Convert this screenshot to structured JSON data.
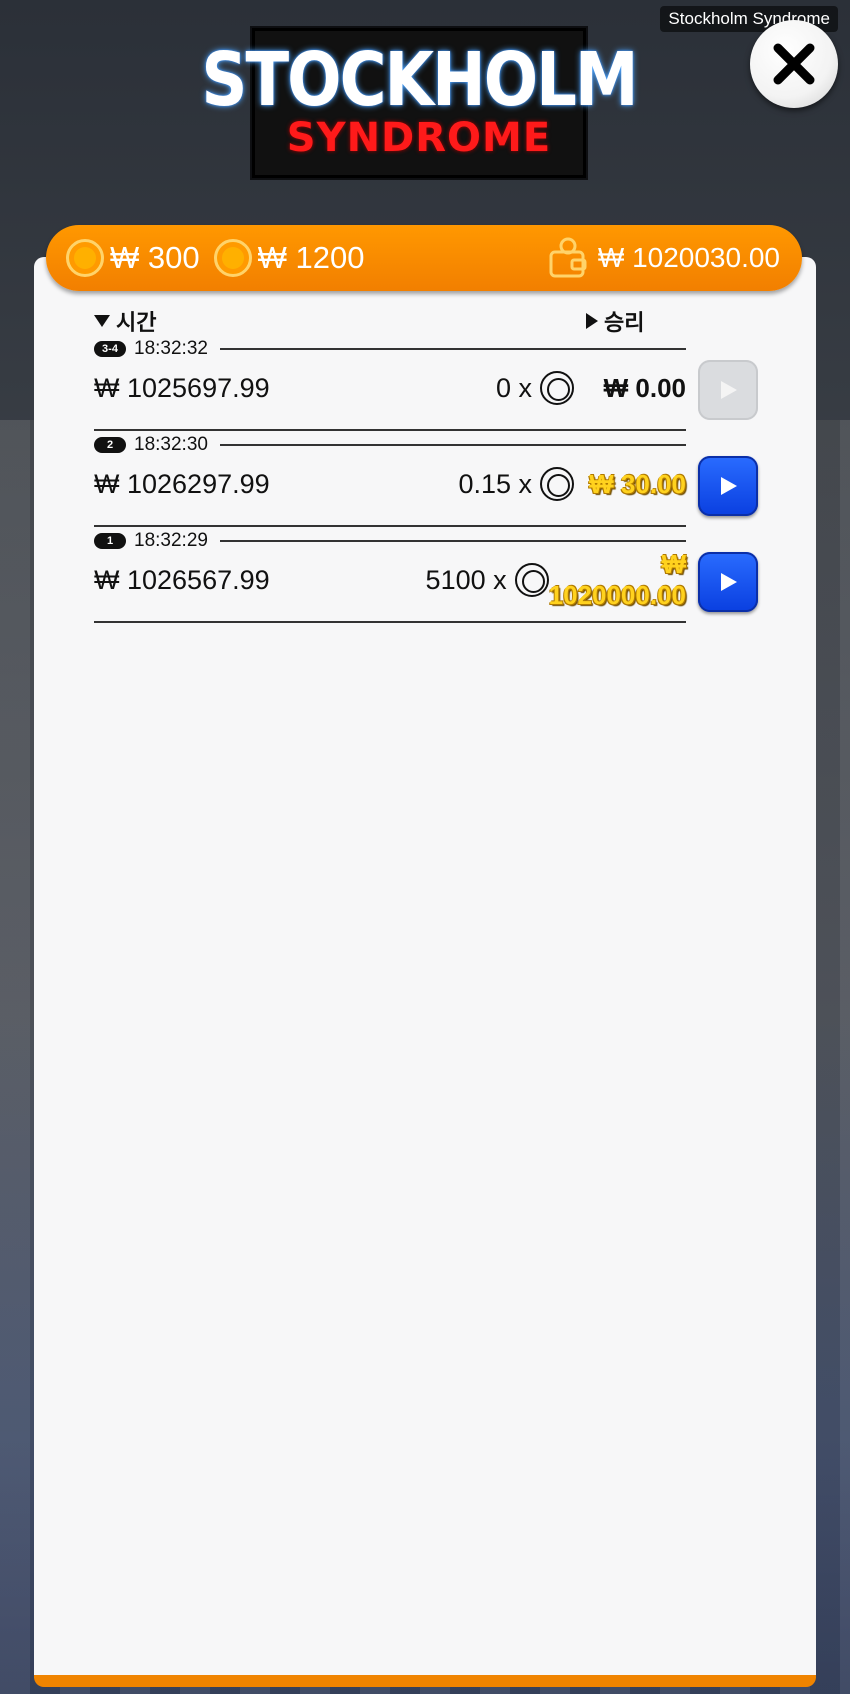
{
  "app": {
    "watermark": "Stockholm Syndrome",
    "logo_top": "STOCKHOLM",
    "logo_bottom": "SYNDROME"
  },
  "top_bar": {
    "bet_1": "₩ 300",
    "bet_2": "₩ 1200",
    "balance": "₩ 1020030.00"
  },
  "headers": {
    "time": "시간",
    "win": "승리"
  },
  "rows": [
    {
      "badge": "3-4",
      "time": "18:32:32",
      "amount": "₩ 1025697.99",
      "multiplier": "0 x",
      "win": "₩ 0.00",
      "win_style": "black",
      "play_enabled": false
    },
    {
      "badge": "2",
      "time": "18:32:30",
      "amount": "₩ 1026297.99",
      "multiplier": "0.15 x",
      "win": "₩ 30.00",
      "win_style": "gold",
      "play_enabled": true
    },
    {
      "badge": "1",
      "time": "18:32:29",
      "amount": "₩ 1026567.99",
      "multiplier": "5100 x",
      "win": "₩ 1020000.00",
      "win_style": "gold",
      "play_enabled": true
    }
  ],
  "icons": {
    "close": "close-icon",
    "chip": "chip-icon",
    "wallet": "wallet-icon",
    "coin": "coin-icon",
    "play": "play-icon"
  },
  "colors": {
    "accent_orange": "#f27f00",
    "play_blue": "#0a3fe0",
    "win_gold": "#ffd21e",
    "logo_red": "#ff1a1a"
  }
}
